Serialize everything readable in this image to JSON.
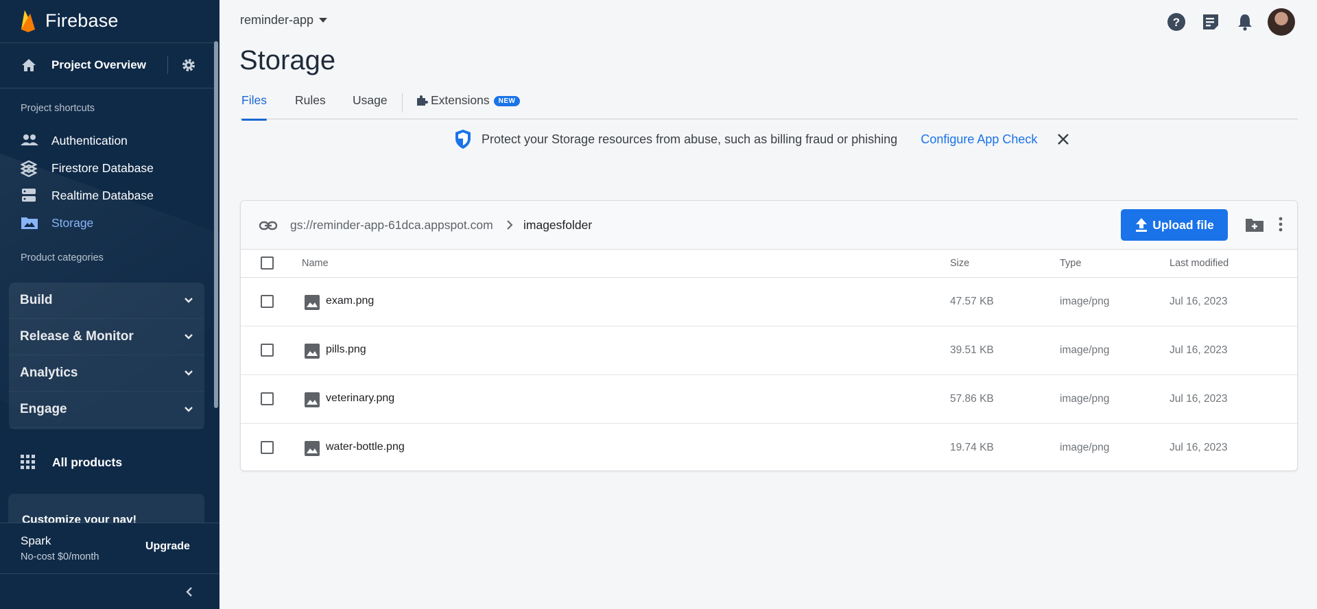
{
  "sidebar": {
    "brand": "Firebase",
    "project_overview": "Project Overview",
    "shortcuts_heading": "Project shortcuts",
    "shortcuts": [
      {
        "label": "Authentication",
        "icon": "people-icon"
      },
      {
        "label": "Firestore Database",
        "icon": "firestore-icon"
      },
      {
        "label": "Realtime Database",
        "icon": "database-icon"
      },
      {
        "label": "Storage",
        "icon": "folder-image-icon",
        "active": true
      }
    ],
    "categories_heading": "Product categories",
    "categories": [
      "Build",
      "Release & Monitor",
      "Analytics",
      "Engage"
    ],
    "all_products": "All products",
    "customize": "Customize your nav!",
    "plan_name": "Spark",
    "plan_cost": "No-cost $0/month",
    "upgrade": "Upgrade"
  },
  "topbar": {
    "project": "reminder-app"
  },
  "page": {
    "title": "Storage",
    "tabs": [
      "Files",
      "Rules",
      "Usage",
      "Extensions"
    ],
    "new_badge": "NEW"
  },
  "banner": {
    "text": "Protect your Storage resources from abuse, such as billing fraud or phishing",
    "link": "Configure App Check"
  },
  "files": {
    "bucket": "gs://reminder-app-61dca.appspot.com",
    "folder": "imagesfolder",
    "upload_label": "Upload file",
    "columns": {
      "name": "Name",
      "size": "Size",
      "type": "Type",
      "modified": "Last modified"
    },
    "rows": [
      {
        "name": "exam.png",
        "size": "47.57 KB",
        "type": "image/png",
        "modified": "Jul 16, 2023"
      },
      {
        "name": "pills.png",
        "size": "39.51 KB",
        "type": "image/png",
        "modified": "Jul 16, 2023"
      },
      {
        "name": "veterinary.png",
        "size": "57.86 KB",
        "type": "image/png",
        "modified": "Jul 16, 2023"
      },
      {
        "name": "water-bottle.png",
        "size": "19.74 KB",
        "type": "image/png",
        "modified": "Jul 16, 2023"
      }
    ]
  },
  "colors": {
    "sidebar_bg": "#0f2a47",
    "accent": "#1a73e8",
    "active_nav": "#8ab4f8",
    "flame": "#ffa000"
  }
}
